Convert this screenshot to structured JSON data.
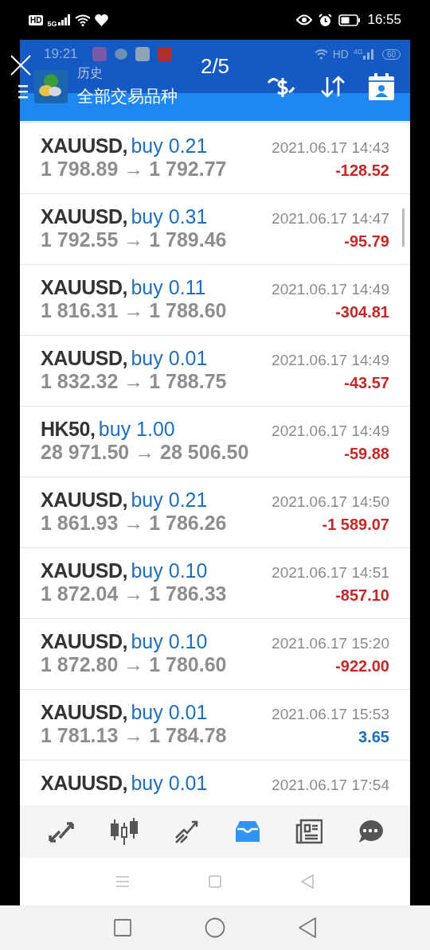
{
  "status_bar": {
    "hd": "HD",
    "network": "5G",
    "time": "16:55"
  },
  "viewer": {
    "counter": "2/5"
  },
  "app_status_bar": {
    "time": "19:21",
    "network": "HD",
    "signal": "4G",
    "battery": "60"
  },
  "header": {
    "subtitle": "历史",
    "title": "全部交易品种"
  },
  "deals": [
    {
      "symbol": "XAUUSD,",
      "side": "buy 0.21",
      "time": "2021.06.17 14:43",
      "prices": "1 798.89 → 1 792.77",
      "profit": "-128.52",
      "color": "#c62828"
    },
    {
      "symbol": "XAUUSD,",
      "side": "buy 0.31",
      "time": "2021.06.17 14:47",
      "prices": "1 792.55 → 1 789.46",
      "profit": "-95.79",
      "color": "#c62828"
    },
    {
      "symbol": "XAUUSD,",
      "side": "buy 0.11",
      "time": "2021.06.17 14:49",
      "prices": "1 816.31 → 1 788.60",
      "profit": "-304.81",
      "color": "#c62828"
    },
    {
      "symbol": "XAUUSD,",
      "side": "buy 0.01",
      "time": "2021.06.17 14:49",
      "prices": "1 832.32 → 1 788.75",
      "profit": "-43.57",
      "color": "#c62828"
    },
    {
      "symbol": "HK50,",
      "side": "buy 1.00",
      "time": "2021.06.17 14:49",
      "prices": "28 971.50 → 28 506.50",
      "profit": "-59.88",
      "color": "#c62828"
    },
    {
      "symbol": "XAUUSD,",
      "side": "buy 0.21",
      "time": "2021.06.17 14:50",
      "prices": "1 861.93 → 1 786.26",
      "profit": "-1 589.07",
      "color": "#c62828"
    },
    {
      "symbol": "XAUUSD,",
      "side": "buy 0.10",
      "time": "2021.06.17 14:51",
      "prices": "1 872.04 → 1 786.33",
      "profit": "-857.10",
      "color": "#c62828"
    },
    {
      "symbol": "XAUUSD,",
      "side": "buy 0.10",
      "time": "2021.06.17 15:20",
      "prices": "1 872.80 → 1 780.60",
      "profit": "-922.00",
      "color": "#c62828"
    },
    {
      "symbol": "XAUUSD,",
      "side": "buy 0.01",
      "time": "2021.06.17 15:53",
      "prices": "1 781.13 → 1 784.78",
      "profit": "3.65",
      "color": "#1e6fc0"
    },
    {
      "symbol": "XAUUSD,",
      "side": "buy 0.01",
      "time": "2021.06.17 17:54"
    }
  ],
  "bottom_tabs": [
    {
      "selected": false
    },
    {
      "selected": false
    },
    {
      "selected": false
    },
    {
      "selected": true
    },
    {
      "selected": false
    },
    {
      "selected": false
    }
  ]
}
